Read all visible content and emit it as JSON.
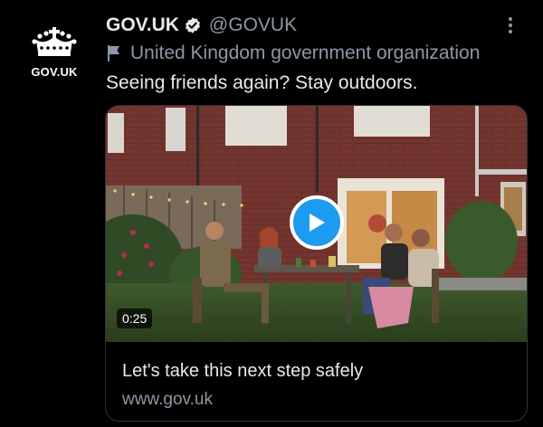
{
  "author": {
    "avatar_label": "GOV.UK",
    "display_name": "GOV.UK",
    "handle": "@GOVUK",
    "verified_icon": "verified-badge-icon",
    "org_icon": "flag-icon",
    "org_label": "United Kingdom government organization"
  },
  "tweet": {
    "text": "Seeing friends again? Stay outdoors."
  },
  "card": {
    "video_duration": "0:25",
    "play_icon": "play-icon",
    "title": "Let's take this next step safely",
    "domain": "www.gov.uk"
  },
  "colors": {
    "background": "#000000",
    "primary_text": "#e7e9ea",
    "secondary_text": "#8b98a5",
    "accent": "#1d9bf0"
  }
}
